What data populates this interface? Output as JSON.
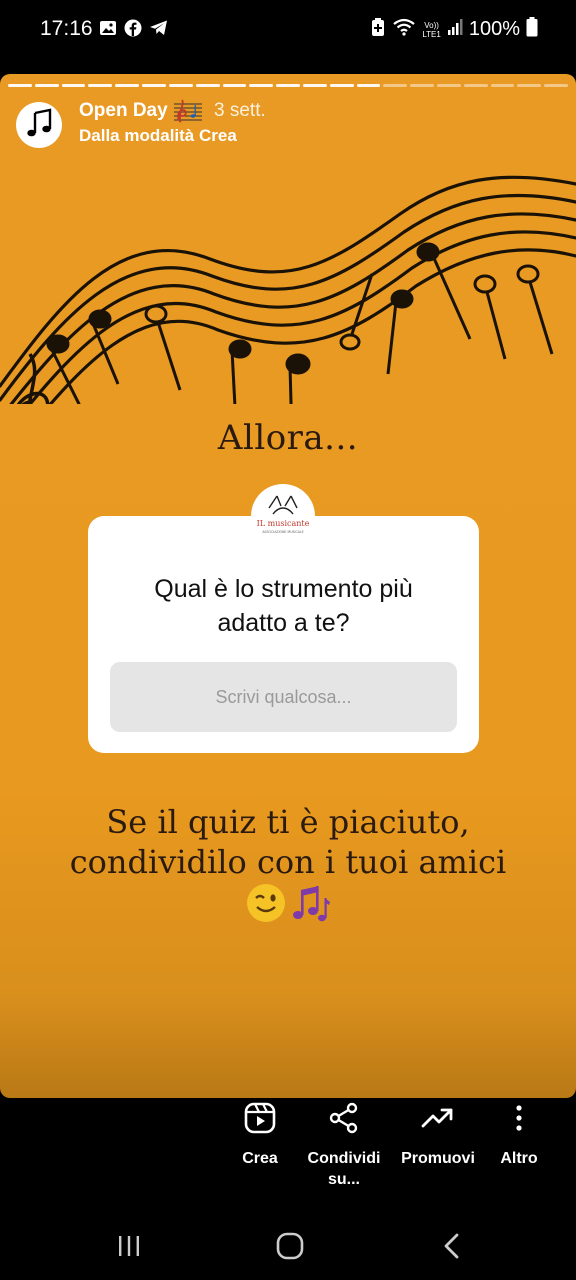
{
  "status": {
    "time": "17:16",
    "battery_text": "100%",
    "lte_label_top": "Vo))",
    "lte_label_bottom": "LTE1"
  },
  "story": {
    "progress": {
      "segments": 21,
      "completed": 14
    },
    "account_name": "Open Day",
    "title_emoji": "🎼",
    "time_ago": "3 sett.",
    "subtitle": "Dalla modalità Crea",
    "heading": "Allora...",
    "logo_text": "IL musicante",
    "logo_subtext": "ASSOCIAZIONE MUSICALE",
    "question": {
      "line1": "Qual è lo strumento più",
      "line2": "adatto a te?",
      "placeholder": "Scrivi qualcosa..."
    },
    "caption_line1": "Se il quiz ti è piaciuto,",
    "caption_line2": "condividilo con i tuoi amici",
    "caption_emojis": "😉🎶"
  },
  "actions": [
    {
      "icon": "reels-icon",
      "label": "Crea"
    },
    {
      "icon": "share-icon",
      "label": "Condividi su..."
    },
    {
      "icon": "trend-up-icon",
      "label": "Promuovi"
    },
    {
      "icon": "more-vertical-icon",
      "label": "Altro"
    }
  ],
  "actions_labels": {
    "crea": "Crea",
    "condividi_1": "Condividi",
    "condividi_2": "su...",
    "promuovi": "Promuovi",
    "altro": "Altro"
  },
  "colors": {
    "story_background": "#e99a24",
    "text_dark": "#2a1a10"
  }
}
